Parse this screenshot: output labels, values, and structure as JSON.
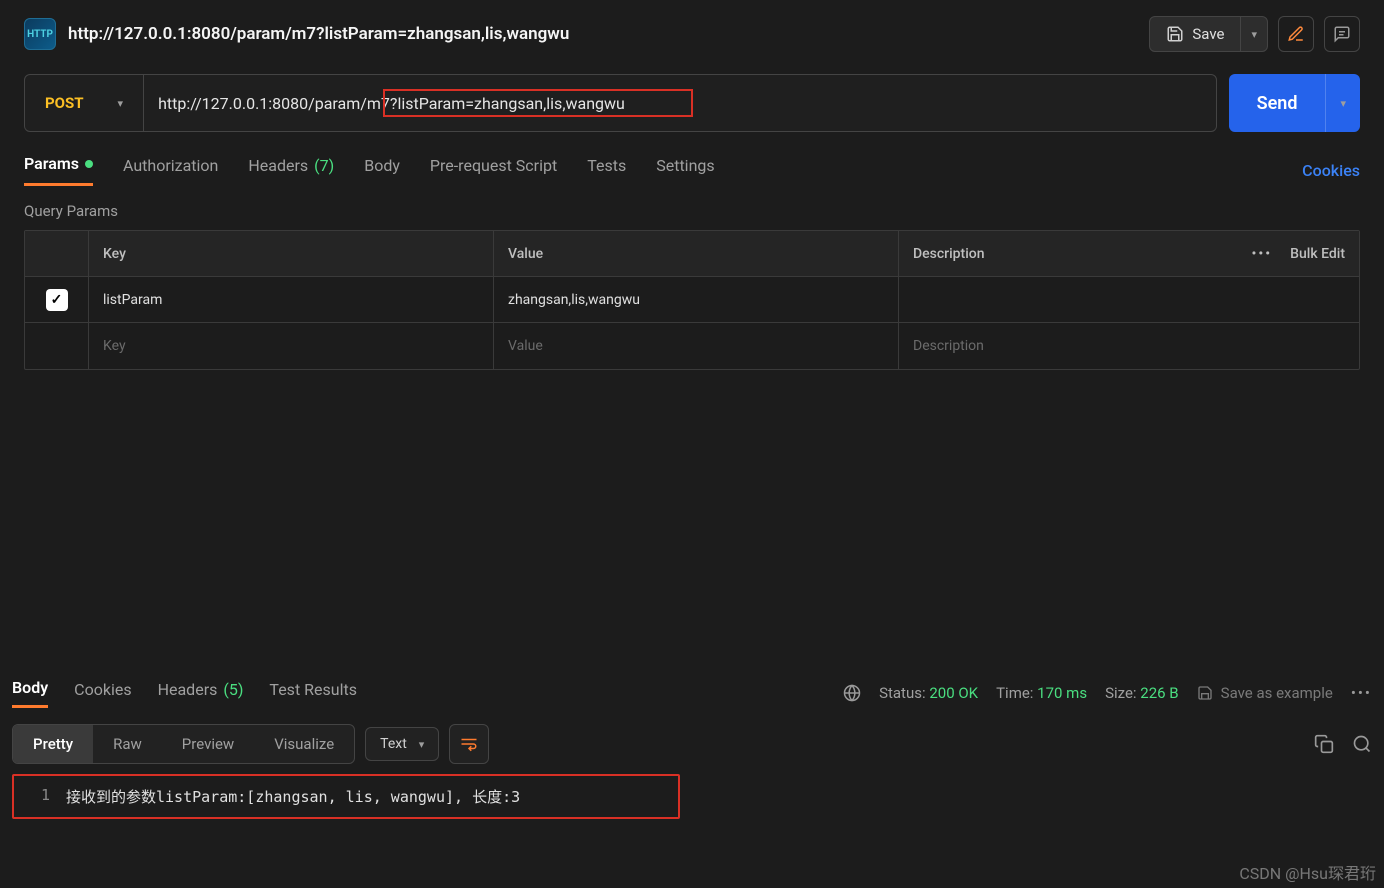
{
  "request": {
    "title": "http://127.0.0.1:8080/param/m7?listParam=zhangsan,lis,wangwu",
    "method": "POST",
    "url_prefix": "http://127.0.0.1:8080/param/",
    "url_highlighted": "m7?listParam=zhangsan,lis,wangwu",
    "full_url": "http://127.0.0.1:8080/param/m7?listParam=zhangsan,lis,wangwu"
  },
  "toolbar": {
    "save_label": "Save",
    "send_label": "Send"
  },
  "tabs": {
    "params": "Params",
    "authorization": "Authorization",
    "headers": "Headers",
    "headers_count": "(7)",
    "body": "Body",
    "prerequest": "Pre-request Script",
    "tests": "Tests",
    "settings": "Settings",
    "cookies_link": "Cookies"
  },
  "query_params": {
    "section_title": "Query Params",
    "columns": {
      "key": "Key",
      "value": "Value",
      "description": "Description"
    },
    "bulk_edit_label": "Bulk Edit",
    "rows": [
      {
        "checked": true,
        "key": "listParam",
        "value": "zhangsan,lis,wangwu",
        "description": ""
      }
    ],
    "placeholders": {
      "key": "Key",
      "value": "Value",
      "description": "Description"
    }
  },
  "response": {
    "tabs": {
      "body": "Body",
      "cookies": "Cookies",
      "headers": "Headers",
      "headers_count": "(5)",
      "test_results": "Test Results"
    },
    "status_label": "Status:",
    "status_value": "200 OK",
    "time_label": "Time:",
    "time_value": "170 ms",
    "size_label": "Size:",
    "size_value": "226 B",
    "save_example_label": "Save as example",
    "view_modes": {
      "pretty": "Pretty",
      "raw": "Raw",
      "preview": "Preview",
      "visualize": "Visualize"
    },
    "content_type": "Text",
    "body_lines": [
      {
        "n": "1",
        "text": "接收到的参数listParam:[zhangsan, lis, wangwu], 长度:3"
      }
    ]
  },
  "watermark": "CSDN @Hsu琛君珩"
}
